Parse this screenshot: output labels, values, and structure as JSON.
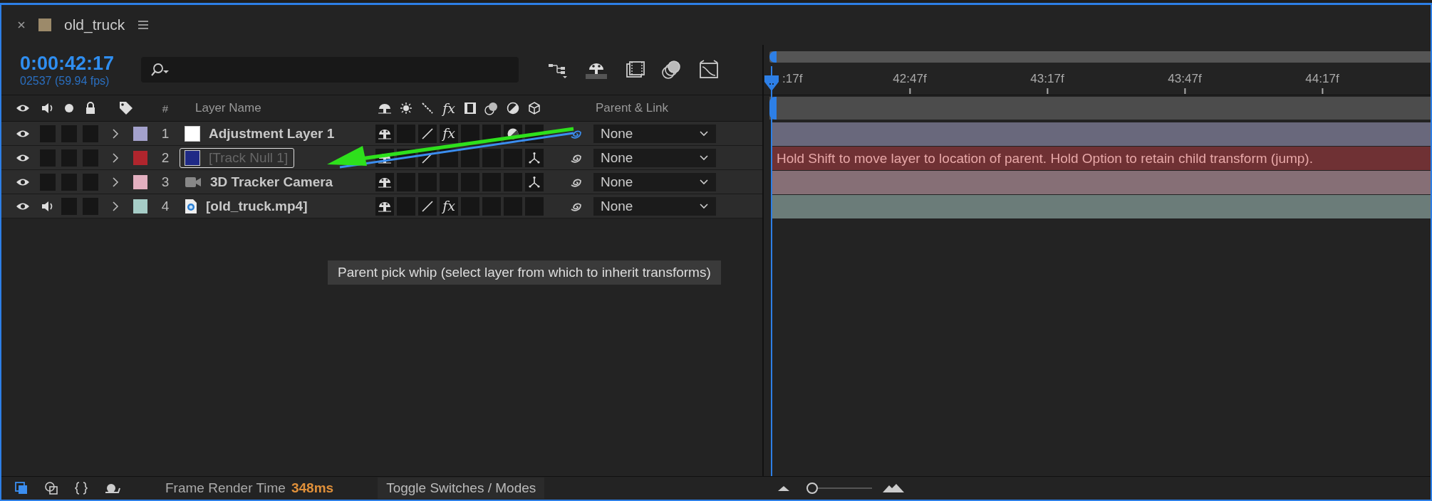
{
  "tab": {
    "title": "old_truck",
    "color": "#9c8a6a"
  },
  "timecode": {
    "time": "0:00:42:17",
    "frames": "02537 (59.94 fps)"
  },
  "columns": {
    "number": "#",
    "layer_name": "Layer Name",
    "effects": "fx",
    "parent": "Parent & Link"
  },
  "layers": [
    {
      "number": "1",
      "name": "Adjustment Layer 1",
      "color": "#a3a1cc",
      "kind": "solid",
      "solid": {
        "color": "#ffffff"
      },
      "visible": true,
      "audio": false,
      "highlighted": false,
      "switches": {
        "shy": true,
        "quality": true,
        "effects": true,
        "effects_glyph": "fx",
        "adjustment": true,
        "three_d": false
      },
      "whip_active": true,
      "parent": "None"
    },
    {
      "number": "2",
      "name": "[Track Null 1]",
      "color": "#b0252d",
      "kind": "solid",
      "solid": {
        "color": "#1f2a86"
      },
      "visible": true,
      "audio": false,
      "highlighted": true,
      "switches": {
        "shy": true,
        "quality": true,
        "effects": false,
        "adjustment": false,
        "three_d": true
      },
      "whip_active": false,
      "parent": "None",
      "bar_hint": "Hold Shift to move layer to location of parent. Hold Option to retain child transform (jump)."
    },
    {
      "number": "3",
      "name": "3D Tracker Camera",
      "color": "#e3b0c0",
      "kind": "camera",
      "visible": true,
      "audio": false,
      "highlighted": false,
      "switches": {
        "shy": true,
        "quality": false,
        "effects": false,
        "adjustment": false,
        "three_d": true
      },
      "whip_active": false,
      "parent": "None"
    },
    {
      "number": "4",
      "name": "[old_truck.mp4]",
      "color": "#a6cdc7",
      "kind": "footage",
      "visible": true,
      "audio": true,
      "highlighted": false,
      "switches": {
        "shy": true,
        "quality": true,
        "effects": true,
        "effects_glyph": "fx",
        "adjustment": false,
        "three_d": false
      },
      "whip_active": false,
      "parent": "None"
    }
  ],
  "tooltip": "Parent pick whip (select layer from which to inherit transforms)",
  "ruler": [
    ":17f",
    "42:47f",
    "43:17f",
    "43:47f",
    "44:17f"
  ],
  "status_bar": {
    "label": "Frame Render Time",
    "value": "348ms",
    "toggle_button": "Toggle Switches / Modes",
    "zoom": {
      "level": 0.1
    }
  }
}
